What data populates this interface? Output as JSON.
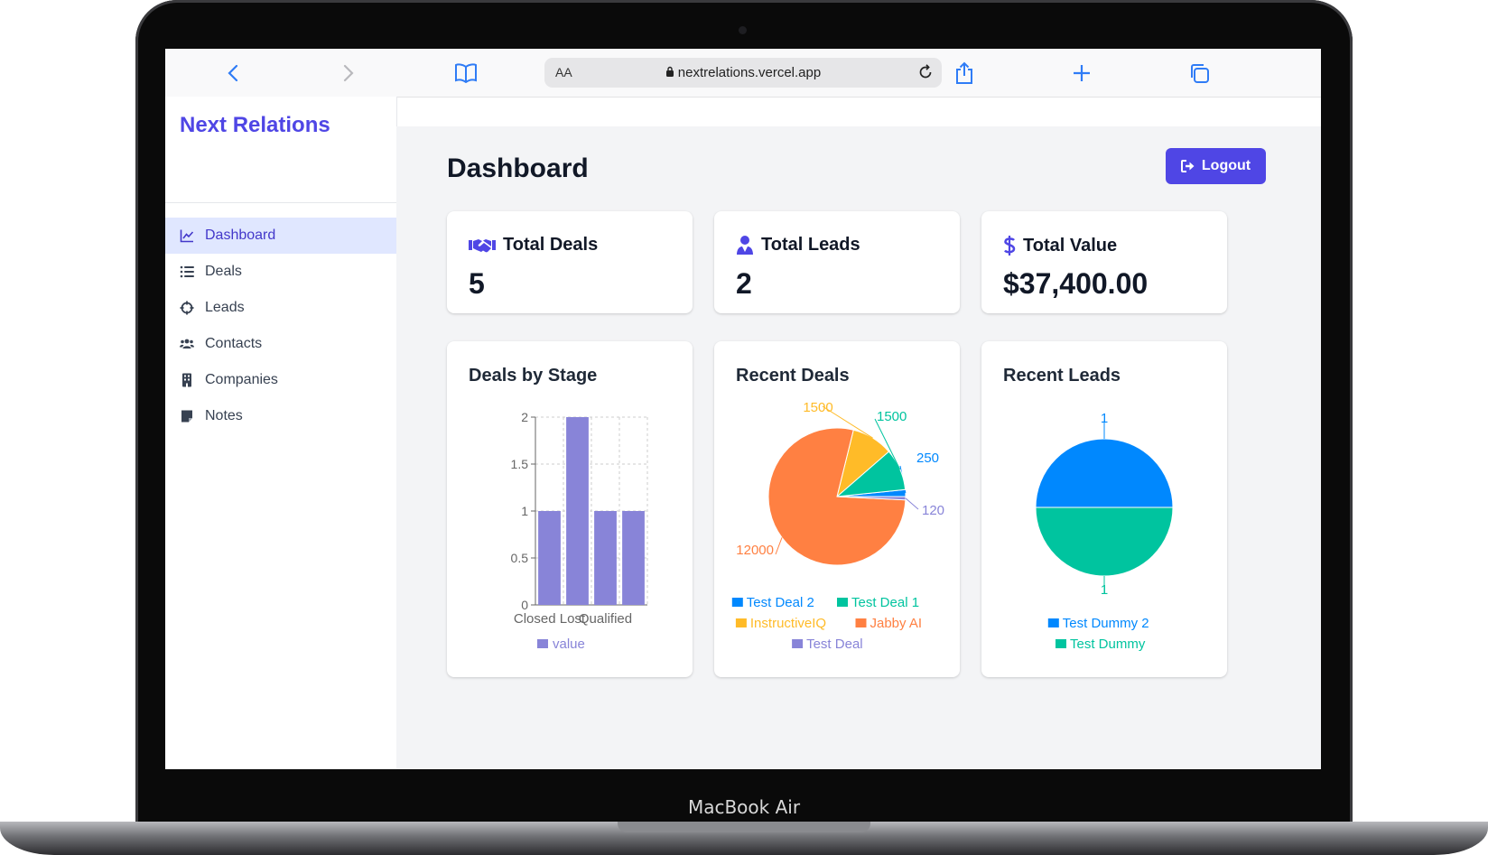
{
  "device": {
    "label": "MacBook Air"
  },
  "browser": {
    "aa_label": "AA",
    "url": "nextrelations.vercel.app"
  },
  "sidebar": {
    "brand": "Next Relations",
    "items": [
      {
        "label": "Dashboard",
        "icon": "chart-line-icon",
        "active": true
      },
      {
        "label": "Deals",
        "icon": "list-icon",
        "active": false
      },
      {
        "label": "Leads",
        "icon": "crosshair-icon",
        "active": false
      },
      {
        "label": "Contacts",
        "icon": "users-icon",
        "active": false
      },
      {
        "label": "Companies",
        "icon": "building-icon",
        "active": false
      },
      {
        "label": "Notes",
        "icon": "note-icon",
        "active": false
      }
    ]
  },
  "main": {
    "title": "Dashboard",
    "logout_label": "Logout",
    "stats": [
      {
        "label": "Total Deals",
        "value": "5",
        "icon": "handshake-icon"
      },
      {
        "label": "Total Leads",
        "value": "2",
        "icon": "user-tie-icon"
      },
      {
        "label": "Total Value",
        "value": "$37,400.00",
        "icon": "dollar-icon"
      }
    ]
  },
  "colors": {
    "accent": "#4f46e5",
    "bar": "#8884d8",
    "blue": "#0088FE",
    "green": "#00C49F",
    "yellow": "#FFBB28",
    "orange": "#FF8042"
  },
  "chart_data": [
    {
      "type": "bar",
      "title": "Deals by Stage",
      "categories": [
        "Closed Lost",
        "",
        "Qualified",
        ""
      ],
      "series": [
        {
          "name": "value",
          "values": [
            1,
            2,
            1,
            1
          ]
        }
      ],
      "ylim": [
        0,
        2
      ],
      "yticks": [
        "0",
        "0.5",
        "1",
        "1.5",
        "2"
      ],
      "grid": true,
      "legend": "bottom"
    },
    {
      "type": "pie",
      "title": "Recent Deals",
      "slices": [
        {
          "name": "Test Deal 2",
          "value": 250,
          "color": "#0088FE",
          "label": "250"
        },
        {
          "name": "Test Deal 1",
          "value": 1500,
          "color": "#00C49F",
          "label": "1500"
        },
        {
          "name": "InstructiveIQ",
          "value": 1500,
          "color": "#FFBB28",
          "label": "1500"
        },
        {
          "name": "Jabby AI",
          "value": 12000,
          "color": "#FF8042",
          "label": "12000"
        },
        {
          "name": "Test Deal",
          "value": 120,
          "color": "#8884d8",
          "label": "120"
        }
      ],
      "legend": "bottom"
    },
    {
      "type": "pie",
      "title": "Recent Leads",
      "slices": [
        {
          "name": "Test Dummy 2",
          "value": 1,
          "color": "#0088FE",
          "label": "1"
        },
        {
          "name": "Test Dummy",
          "value": 1,
          "color": "#00C49F",
          "label": "1"
        }
      ],
      "legend": "bottom"
    }
  ]
}
